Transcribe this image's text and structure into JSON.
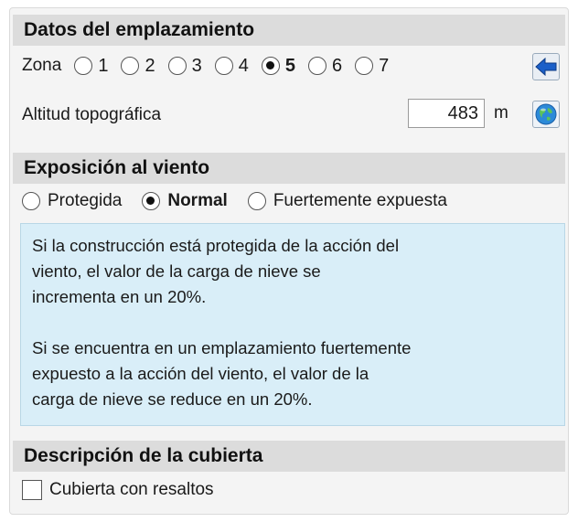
{
  "site_data": {
    "title": "Datos del emplazamiento",
    "zone": {
      "label": "Zona",
      "options": [
        "1",
        "2",
        "3",
        "4",
        "5",
        "6",
        "7"
      ],
      "selected": "5"
    },
    "back_button_icon": "arrow-left-icon",
    "altitude": {
      "label": "Altitud topográfica",
      "value": "483",
      "unit": "m",
      "globe_button_icon": "globe-icon"
    }
  },
  "wind_exposure": {
    "title": "Exposición al viento",
    "options": [
      "Protegida",
      "Normal",
      "Fuertemente expuesta"
    ],
    "selected": "Normal",
    "info_paragraph_1": "Si la construcción está protegida de la acción del\nviento, el valor de la carga de nieve se\nincrementa en un 20%.",
    "info_paragraph_2": "Si se encuentra en un emplazamiento fuertemente\nexpuesto a la acción del viento, el valor de la\ncarga de nieve se reduce en un 20%."
  },
  "roof_description": {
    "title": "Descripción de la cubierta",
    "checkbox_label": "Cubierta con resaltos",
    "checked": false
  },
  "colors": {
    "header_bg": "#dcdcdc",
    "info_bg": "#d9eef8",
    "arrow_blue": "#1a5fc8"
  }
}
